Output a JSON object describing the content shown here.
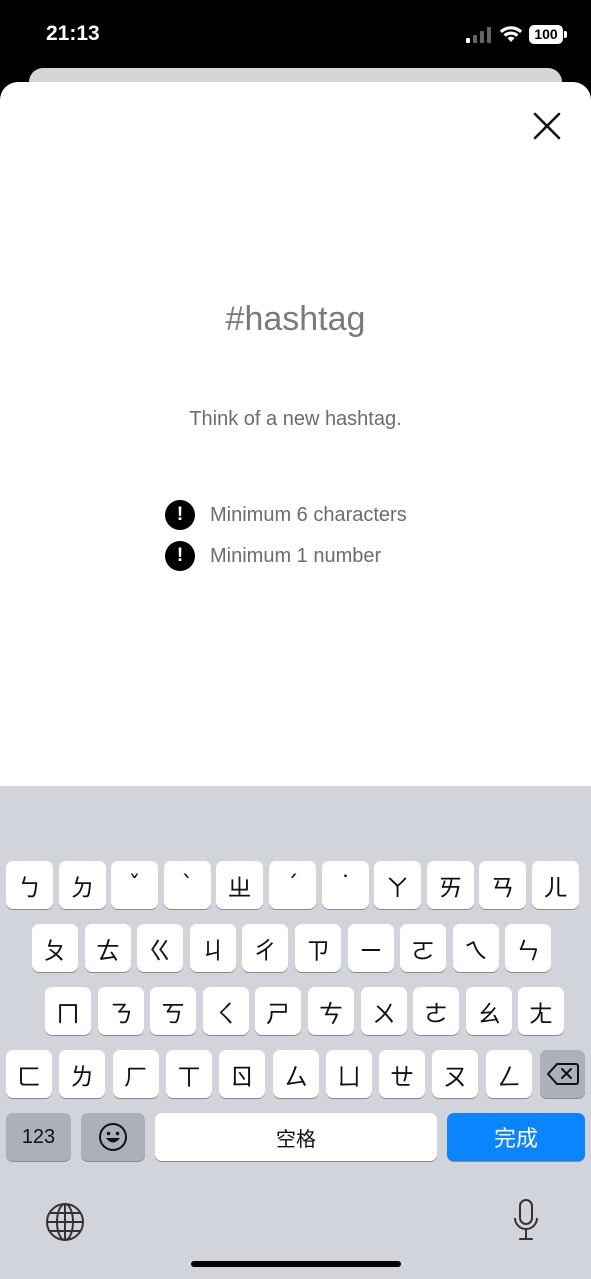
{
  "status_bar": {
    "time": "21:13",
    "battery": "100"
  },
  "sheet": {
    "title": "#hashtag",
    "subtitle": "Think of a new hashtag.",
    "requirements": [
      {
        "icon": "exclamation-icon",
        "text": "Minimum 6 characters"
      },
      {
        "icon": "exclamation-icon",
        "text": "Minimum 1 number"
      }
    ]
  },
  "keyboard": {
    "row1": [
      "ㄅ",
      "ㄉ",
      "ˇ",
      "ˋ",
      "ㄓ",
      "ˊ",
      "˙",
      "ㄚ",
      "ㄞ",
      "ㄢ",
      "ㄦ"
    ],
    "row2": [
      "ㄆ",
      "ㄊ",
      "ㄍ",
      "ㄐ",
      "ㄔ",
      "ㄗ",
      "ㄧ",
      "ㄛ",
      "ㄟ",
      "ㄣ"
    ],
    "row3": [
      "ㄇ",
      "ㄋ",
      "ㄎ",
      "ㄑ",
      "ㄕ",
      "ㄘ",
      "ㄨ",
      "ㄜ",
      "ㄠ",
      "ㄤ"
    ],
    "row4": [
      "ㄈ",
      "ㄌ",
      "ㄏ",
      "ㄒ",
      "ㄖ",
      "ㄙ",
      "ㄩ",
      "ㄝ",
      "ㄡ",
      "ㄥ"
    ],
    "numbers_label": "123",
    "space_label": "空格",
    "done_label": "完成"
  }
}
